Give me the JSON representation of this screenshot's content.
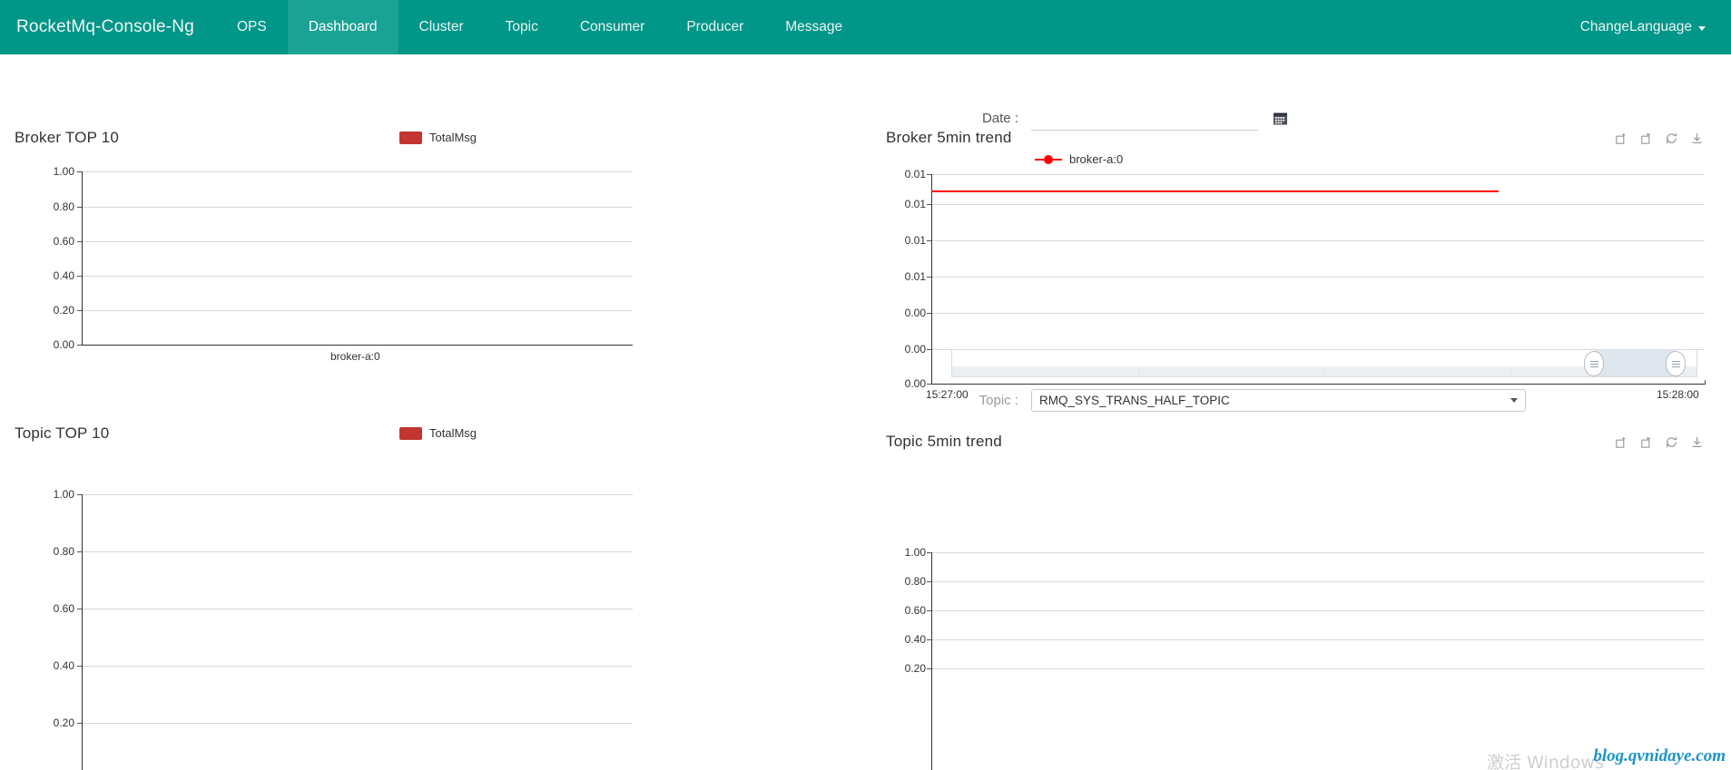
{
  "navbar": {
    "brand": "RocketMq-Console-Ng",
    "items": [
      {
        "label": "OPS",
        "active": false
      },
      {
        "label": "Dashboard",
        "active": true
      },
      {
        "label": "Cluster",
        "active": false
      },
      {
        "label": "Topic",
        "active": false
      },
      {
        "label": "Consumer",
        "active": false
      },
      {
        "label": "Producer",
        "active": false
      },
      {
        "label": "Message",
        "active": false
      }
    ],
    "change_language": "ChangeLanguage",
    "bg_color": "#009688",
    "active_bg_color": "#1aa294"
  },
  "filters": {
    "date_label": "Date :",
    "date_value": "",
    "date_placeholder": "",
    "calendar_icon": "calendar-icon",
    "topic_label": "Topic :",
    "topic_selected": "RMQ_SYS_TRANS_HALF_TOPIC",
    "topic_options": [
      "RMQ_SYS_TRANS_HALF_TOPIC"
    ]
  },
  "toolbox": {
    "icons": [
      "zoom-area-icon",
      "zoom-restore-icon",
      "refresh-icon",
      "download-icon"
    ]
  },
  "chart_data": [
    {
      "id": "broker-top-10",
      "type": "bar",
      "title": "Broker TOP 10",
      "categories": [
        "broker-a:0"
      ],
      "series": [
        {
          "name": "TotalMsg",
          "values": [
            0
          ],
          "color": "#c23531"
        }
      ],
      "legend": [
        "TotalMsg"
      ],
      "legend_position": "top-center",
      "yticks": [
        "0.00",
        "0.20",
        "0.40",
        "0.60",
        "0.80",
        "1.00"
      ],
      "ylim": [
        0,
        1
      ],
      "xlabel": "",
      "ylabel": "",
      "grid": true
    },
    {
      "id": "broker-5min-trend",
      "type": "line",
      "title": "Broker 5min trend",
      "legend": [
        "broker-a:0"
      ],
      "legend_position": "top-center",
      "legend_color": "#ff0000",
      "yticks": [
        "0.00",
        "0.00",
        "0.00",
        "0.01",
        "0.01",
        "0.01",
        "0.01"
      ],
      "xticks": [
        "15:27:00",
        "15:28:00"
      ],
      "series": [
        {
          "name": "broker-a:0",
          "color": "#ff0000",
          "constant_value": 0.0085,
          "x_start": "15:27:00",
          "x_end": "15:27:47"
        }
      ],
      "grid": true,
      "datazoom": {
        "start_percent": 86,
        "end_percent": 97
      }
    },
    {
      "id": "topic-top-10",
      "type": "bar",
      "title": "Topic TOP 10",
      "categories": [],
      "series": [
        {
          "name": "TotalMsg",
          "values": [],
          "color": "#c23531"
        }
      ],
      "legend": [
        "TotalMsg"
      ],
      "legend_position": "top-center",
      "yticks": [
        "0.20",
        "0.40",
        "0.60",
        "0.80",
        "1.00"
      ],
      "ylim": [
        0,
        1
      ],
      "grid": true
    },
    {
      "id": "topic-5min-trend",
      "type": "line",
      "title": "Topic 5min trend",
      "legend": [],
      "yticks": [
        "0.20",
        "0.40",
        "0.60",
        "0.80",
        "1.00"
      ],
      "ylim": [
        0,
        1
      ],
      "series": [],
      "grid": true
    }
  ],
  "watermarks": {
    "blog": "blog.qvnidaye.com",
    "windows": "激活 Windows",
    "blog_color": "#1b94c9"
  }
}
